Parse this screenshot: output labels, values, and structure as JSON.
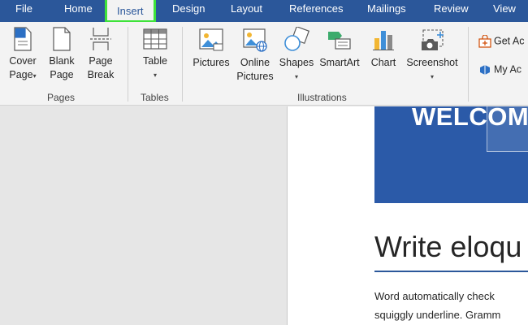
{
  "tabs": [
    "File",
    "Home",
    "Insert",
    "Design",
    "Layout",
    "References",
    "Mailings",
    "Review",
    "View"
  ],
  "active_tab": "Insert",
  "ribbon": {
    "pages": {
      "cover_page_line1": "Cover",
      "cover_page_line2": "Page",
      "blank_page_line1": "Blank",
      "blank_page_line2": "Page",
      "page_break_line1": "Page",
      "page_break_line2": "Break",
      "group": "Pages"
    },
    "tables": {
      "table": "Table",
      "group": "Tables"
    },
    "illustrations": {
      "pictures": "Pictures",
      "online_pictures_line1": "Online",
      "online_pictures_line2": "Pictures",
      "shapes": "Shapes",
      "smartart": "SmartArt",
      "chart": "Chart",
      "screenshot": "Screenshot",
      "group": "Illustrations"
    },
    "addins": {
      "get_addins": "Get Ac",
      "my_addins": "My Ac"
    }
  },
  "document": {
    "banner_text": "WELCOM",
    "heading": "Write eloqu",
    "body_line1": "Word automatically check",
    "body_line2": "squiggly underline. Gramm"
  },
  "colors": {
    "ribbon_blue": "#2b579a",
    "highlight_green": "#3ee23a",
    "banner_blue": "#2b5aa8"
  }
}
